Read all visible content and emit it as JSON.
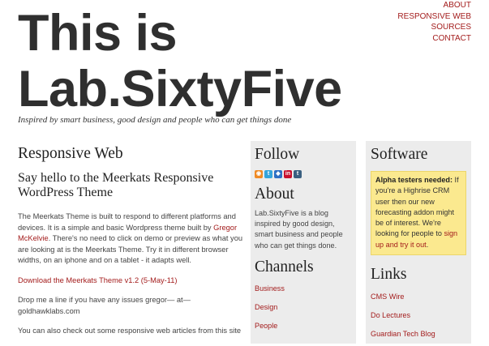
{
  "nav": {
    "items": [
      "ABOUT",
      "RESPONSIVE WEB",
      "SOURCES",
      "CONTACT"
    ]
  },
  "header": {
    "title_line1": "This is",
    "title_line2": "Lab.SixtyFive",
    "tagline": "Inspired by smart business, good design and people who can get things done"
  },
  "main": {
    "heading": "Responsive Web",
    "subheading": "Say hello to the Meerkats Responsive WordPress Theme",
    "p1_before": "The Meerkats Theme is built to respond to different platforms and devices. It is a simple and basic Wordpress theme built by ",
    "p1_link": "Gregor McKelvie",
    "p1_after": ". There's no need to click on demo or preview as what you are looking at is the Meerkats Theme. Try it in different browser widths, on an iphone and on a tablet - it adapts well.",
    "download_link": "Download the Meerkats Theme v1.2 (5-May-11)",
    "p2": "Drop me a line if you have any issues gregor— at— goldhawklabs.com",
    "p3": "You can also check out some responsive web articles from this site"
  },
  "sidebar1": {
    "follow_heading": "Follow",
    "social_icons": [
      "rss-icon",
      "twitter-icon",
      "delicious-icon",
      "linkedin-icon",
      "tumblr-icon"
    ],
    "about_heading": "About",
    "about_text": "Lab.SixtyFive is a blog inspired by good design, smart business and people who can get things done.",
    "channels_heading": "Channels",
    "channels": [
      "Business",
      "Design",
      "People"
    ]
  },
  "sidebar2": {
    "software_heading": "Software",
    "notice_bold": "Alpha testers needed:",
    "notice_text": " If you're a Highrise CRM user then our new forecasting addon might be of interest. We're looking for people to ",
    "notice_link": "sign up and try it out",
    "notice_end": ".",
    "links_heading": "Links",
    "links": [
      "CMS Wire",
      "Do Lectures",
      "Guardian Tech Blog"
    ]
  },
  "colors": {
    "link": "#a31c1c",
    "sidebar_bg": "#ececec",
    "notice_bg": "#fbe98f"
  }
}
